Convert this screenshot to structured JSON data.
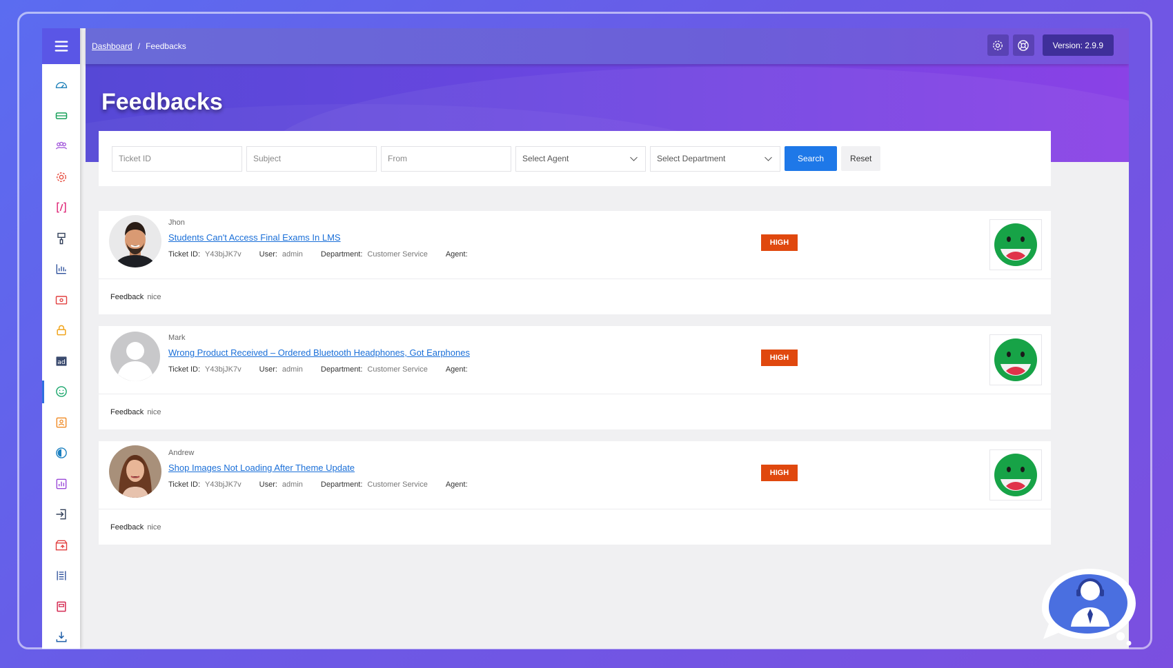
{
  "breadcrumb": {
    "home": "Dashboard",
    "separator": "/",
    "current": "Feedbacks"
  },
  "topbar": {
    "version": "Version: 2.9.9"
  },
  "page": {
    "title": "Feedbacks"
  },
  "filters": {
    "ticket_id_placeholder": "Ticket ID",
    "subject_placeholder": "Subject",
    "from_placeholder": "From",
    "agent_select": "Select Agent",
    "department_select": "Select Department",
    "search_label": "Search",
    "reset_label": "Reset"
  },
  "labels": {
    "ticket_id": "Ticket ID:",
    "user": "User:",
    "department": "Department:",
    "agent": "Agent:",
    "feedback": "Feedback"
  },
  "feedbacks": [
    {
      "name": "Jhon",
      "subject": "Students Can't Access Final Exams In LMS",
      "ticket_id": "Y43bjJK7v",
      "user": "admin",
      "department": "Customer Service",
      "agent": "",
      "priority": "HIGH",
      "feedback": "nice",
      "rating_icon": "happy-face-icon"
    },
    {
      "name": "Mark",
      "subject": "Wrong Product Received – Ordered Bluetooth Headphones, Got Earphones",
      "ticket_id": "Y43bjJK7v",
      "user": "admin",
      "department": "Customer Service",
      "agent": "",
      "priority": "HIGH",
      "feedback": "nice",
      "rating_icon": "happy-face-icon"
    },
    {
      "name": "Andrew",
      "subject": "Shop Images Not Loading After Theme Update",
      "ticket_id": "Y43bjJK7v",
      "user": "admin",
      "department": "Customer Service",
      "agent": "",
      "priority": "HIGH",
      "feedback": "nice",
      "rating_icon": "happy-face-icon"
    }
  ],
  "colors": {
    "accent": "#1e78e8",
    "priority_high": "#e0480e",
    "emoji_green": "#17a347",
    "hero_start": "#5648d6",
    "hero_end": "#8a42e6"
  }
}
